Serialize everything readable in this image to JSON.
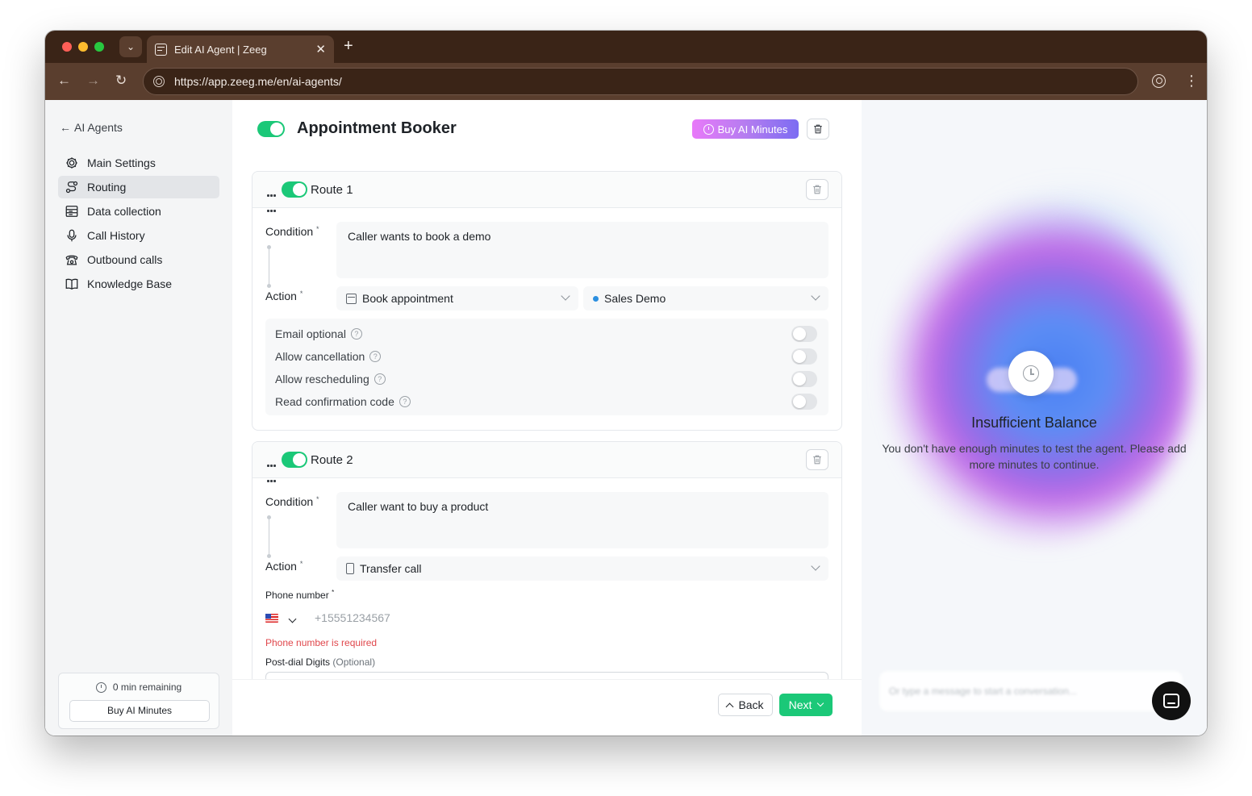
{
  "browser": {
    "tab_title": "Edit AI Agent | Zeeg",
    "url": "https://app.zeeg.me/en/ai-agents/"
  },
  "sidebar": {
    "back_label": "AI Agents",
    "items": [
      {
        "label": "Main Settings",
        "icon": "gear-icon",
        "active": false
      },
      {
        "label": "Routing",
        "icon": "routing-icon",
        "active": true
      },
      {
        "label": "Data collection",
        "icon": "form-icon",
        "active": false
      },
      {
        "label": "Call History",
        "icon": "microphone-icon",
        "active": false
      },
      {
        "label": "Outbound calls",
        "icon": "phone-icon",
        "active": false
      },
      {
        "label": "Knowledge Base",
        "icon": "book-icon",
        "active": false
      }
    ],
    "balance": {
      "remaining": "0 min remaining",
      "button": "Buy AI Minutes"
    }
  },
  "header": {
    "agent_name": "Appointment Booker",
    "enabled": true,
    "buy_button": "Buy AI Minutes"
  },
  "routes": [
    {
      "name": "Route 1",
      "enabled": true,
      "condition_label": "Condition",
      "condition": "Caller wants to book a demo",
      "action_label": "Action",
      "action": "Book appointment",
      "event": "Sales Demo",
      "options": [
        {
          "label": "Email optional",
          "on": false
        },
        {
          "label": "Allow cancellation",
          "on": false
        },
        {
          "label": "Allow rescheduling",
          "on": false
        },
        {
          "label": "Read confirmation code",
          "on": false
        }
      ]
    },
    {
      "name": "Route 2",
      "enabled": true,
      "condition_label": "Condition",
      "condition": "Caller want to buy a product",
      "action_label": "Action",
      "action": "Transfer call",
      "phone_label": "Phone number",
      "phone_placeholder": "+15551234567",
      "phone_error": "Phone number is required",
      "postdial_label": "Post-dial Digits",
      "postdial_optional": "(Optional)"
    }
  ],
  "footer": {
    "back": "Back",
    "next": "Next"
  },
  "test_panel": {
    "title": "Insufficient Balance",
    "message": "You don't have enough minutes to test the agent. Please add more minutes to continue.",
    "chat_placeholder": "Or type a message to start a conversation..."
  },
  "colors": {
    "accent_green": "#1bc878",
    "error_red": "#e0474c",
    "browser_chrome": "#3a2417"
  }
}
